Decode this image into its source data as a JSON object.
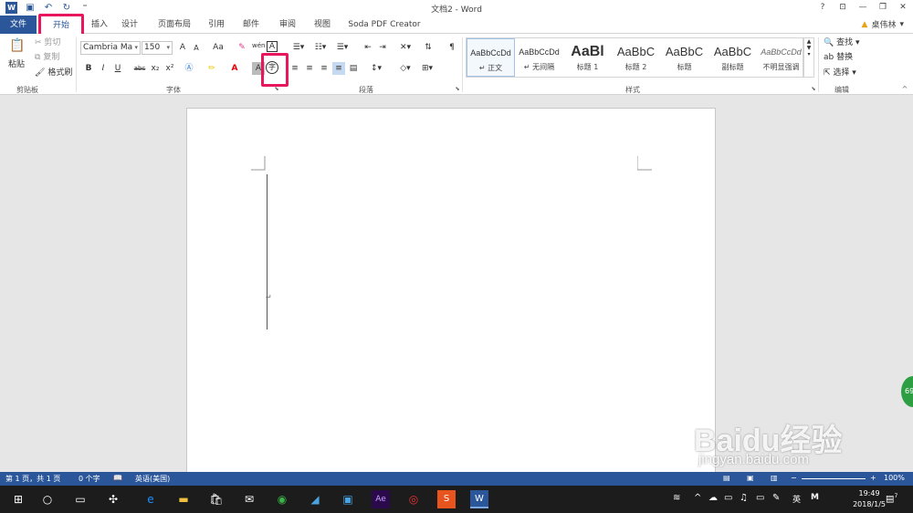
{
  "titlebar": {
    "title": "文档2 - Word",
    "app_icon": "W",
    "controls": [
      "?",
      "⊡",
      "—",
      "❐",
      "✕"
    ]
  },
  "tabs": {
    "file": "文件",
    "home": "开始",
    "insert": "插入",
    "design": "设计",
    "layout": "页面布局",
    "references": "引用",
    "mailings": "邮件",
    "review": "审阅",
    "view": "视图",
    "soda": "Soda PDF Creator"
  },
  "user": {
    "name": "桌伟林"
  },
  "clipboard": {
    "paste": "粘贴",
    "cut": "剪切",
    "copy": "复制",
    "format_painter": "格式刷",
    "label": "剪贴板"
  },
  "font": {
    "name": "Cambria Ma",
    "size": "150",
    "label": "字体",
    "bold": "B",
    "italic": "I",
    "underline": "U",
    "strike": "abc",
    "sub": "x₂",
    "sup": "x²",
    "grow": "A",
    "shrink": "A",
    "case": "Aa",
    "wen": "wén",
    "box": "A",
    "circle": "字"
  },
  "paragraph": {
    "label": "段落"
  },
  "styles": {
    "label": "样式",
    "items": [
      {
        "preview": "AaBbCcDd",
        "name": "↵ 正文"
      },
      {
        "preview": "AaBbCcDd",
        "name": "↵ 无间隔"
      },
      {
        "preview": "AaBl",
        "name": "标题 1"
      },
      {
        "preview": "AaBbC",
        "name": "标题 2"
      },
      {
        "preview": "AaBbC",
        "name": "标题"
      },
      {
        "preview": "AaBbC",
        "name": "副标题"
      },
      {
        "preview": "AaBbCcDd",
        "name": "不明显强调"
      }
    ]
  },
  "editing": {
    "find": "查找",
    "replace": "替换",
    "select": "选择",
    "label": "编辑"
  },
  "document": {
    "para_mark": "↵"
  },
  "status": {
    "page": "第 1 页，共 1 页",
    "words": "0 个字",
    "language": "英语(美国)",
    "zoom": "100%"
  },
  "taskbar": {
    "time": "19:49",
    "date": "2018/1/5",
    "ime": "英",
    "notif_count": "7"
  },
  "floating": {
    "badge": "69"
  },
  "watermark": {
    "brand": "Baidu经验",
    "url": "jingyan.baidu.com"
  }
}
